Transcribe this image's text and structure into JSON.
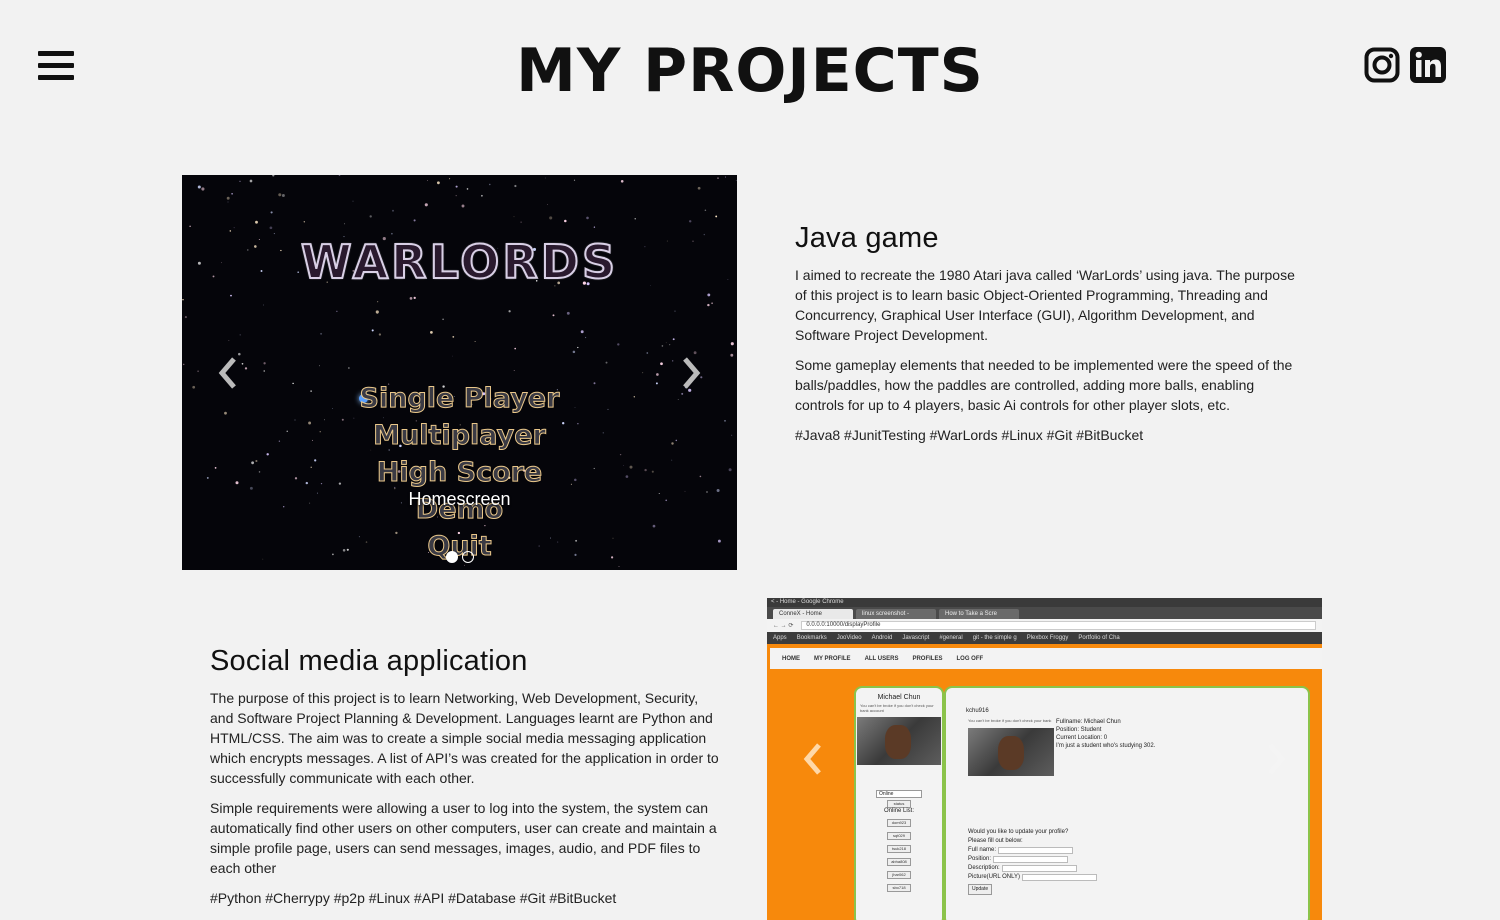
{
  "header": {
    "title": "MY PROJECTS",
    "menu_icon": "hamburger-menu-icon",
    "social_icons": [
      "instagram-icon",
      "linkedin-icon"
    ]
  },
  "projects": [
    {
      "title": "Java game",
      "paragraphs": [
        "I aimed to recreate the 1980 Atari java called ‘WarLords’ using java. The purpose of this project is to learn basic Object-Oriented Programming, Threading and Concurrency, Graphical User Interface (GUI), Algorithm Development, and Software Project Development.",
        "Some gameplay elements that needed to be implemented were the speed of the balls/paddles, how the paddles are controlled, adding more balls, enabling controls for up to 4 players, basic Ai controls for other player slots, etc."
      ],
      "tags": "#Java8 #JunitTesting #WarLords #Linux #Git #BitBucket",
      "carousel": {
        "logo_text": "WARLORDS",
        "menu_items": [
          "Single Player",
          "Multiplayer",
          "High Score",
          "Demo",
          "Quit"
        ],
        "caption": "Homescreen",
        "slide_count": 2,
        "active_index": 0
      }
    },
    {
      "title": "Social media application",
      "paragraphs": [
        "The purpose of this project is to learn Networking, Web Development, Security, and Software Project Planning & Development. Languages learnt are Python and HTML/CSS. The aim was to create a simple social media messaging application which encrypts messages. A list of API’s was created for the application in order to successfully communicate with each other.",
        "Simple requirements were allowing a user to log into the system, the system can automatically find other users on other computers, user can create and maintain a simple profile page, users can send messages, images, audio, and PDF files to each other"
      ],
      "tags": "#Python #Cherrypy #p2p #Linux #API #Database #Git #BitBucket",
      "carousel": {
        "window_title": "< - Home - Google Chrome",
        "tabs": [
          "ConneX - Home",
          "linux screenshot -",
          "How to Take a Scre"
        ],
        "url": "0.0.0.0:10000/displayProfile",
        "bookmarks": [
          "Apps",
          "Bookmarks",
          "JooVideo",
          "Android",
          "Javascript",
          "#general",
          "git - the simple g",
          "Plexbox Froggy",
          "Portfolio of Cha"
        ],
        "nav_items": [
          "HOME",
          "MY PROFILE",
          "ALL USERS",
          "PROFILES",
          "LOG OFF"
        ],
        "left_name": "Michael Chun",
        "left_note": "You can't be broke if you don't check your bank account",
        "online_select": "Online",
        "status_btn": "status",
        "online_list_label": "Online List:",
        "online_users": [
          "dom923",
          "sqt029",
          "tsuk218",
          "abha808",
          "jhar062",
          "sbo718"
        ],
        "profile_user": "kchu916",
        "profile_note": "You can't be broke if you don't check your bank",
        "profile_info": [
          "Fullname: Michael Chun",
          "Position: Student",
          "Current Location: 0",
          "I'm just a student who's studying 302."
        ],
        "form_prompt": "Would you like to update your profile?",
        "form_sub": "Please fill out below:",
        "form_fields": [
          "Full name:",
          "Position:",
          "Description:",
          "Picture(URL ONLY)"
        ],
        "update_btn": "Update"
      }
    }
  ],
  "colors": {
    "background": "#f2f2f2",
    "app_orange": "#f7890c",
    "app_green_border": "#8bc34a"
  }
}
